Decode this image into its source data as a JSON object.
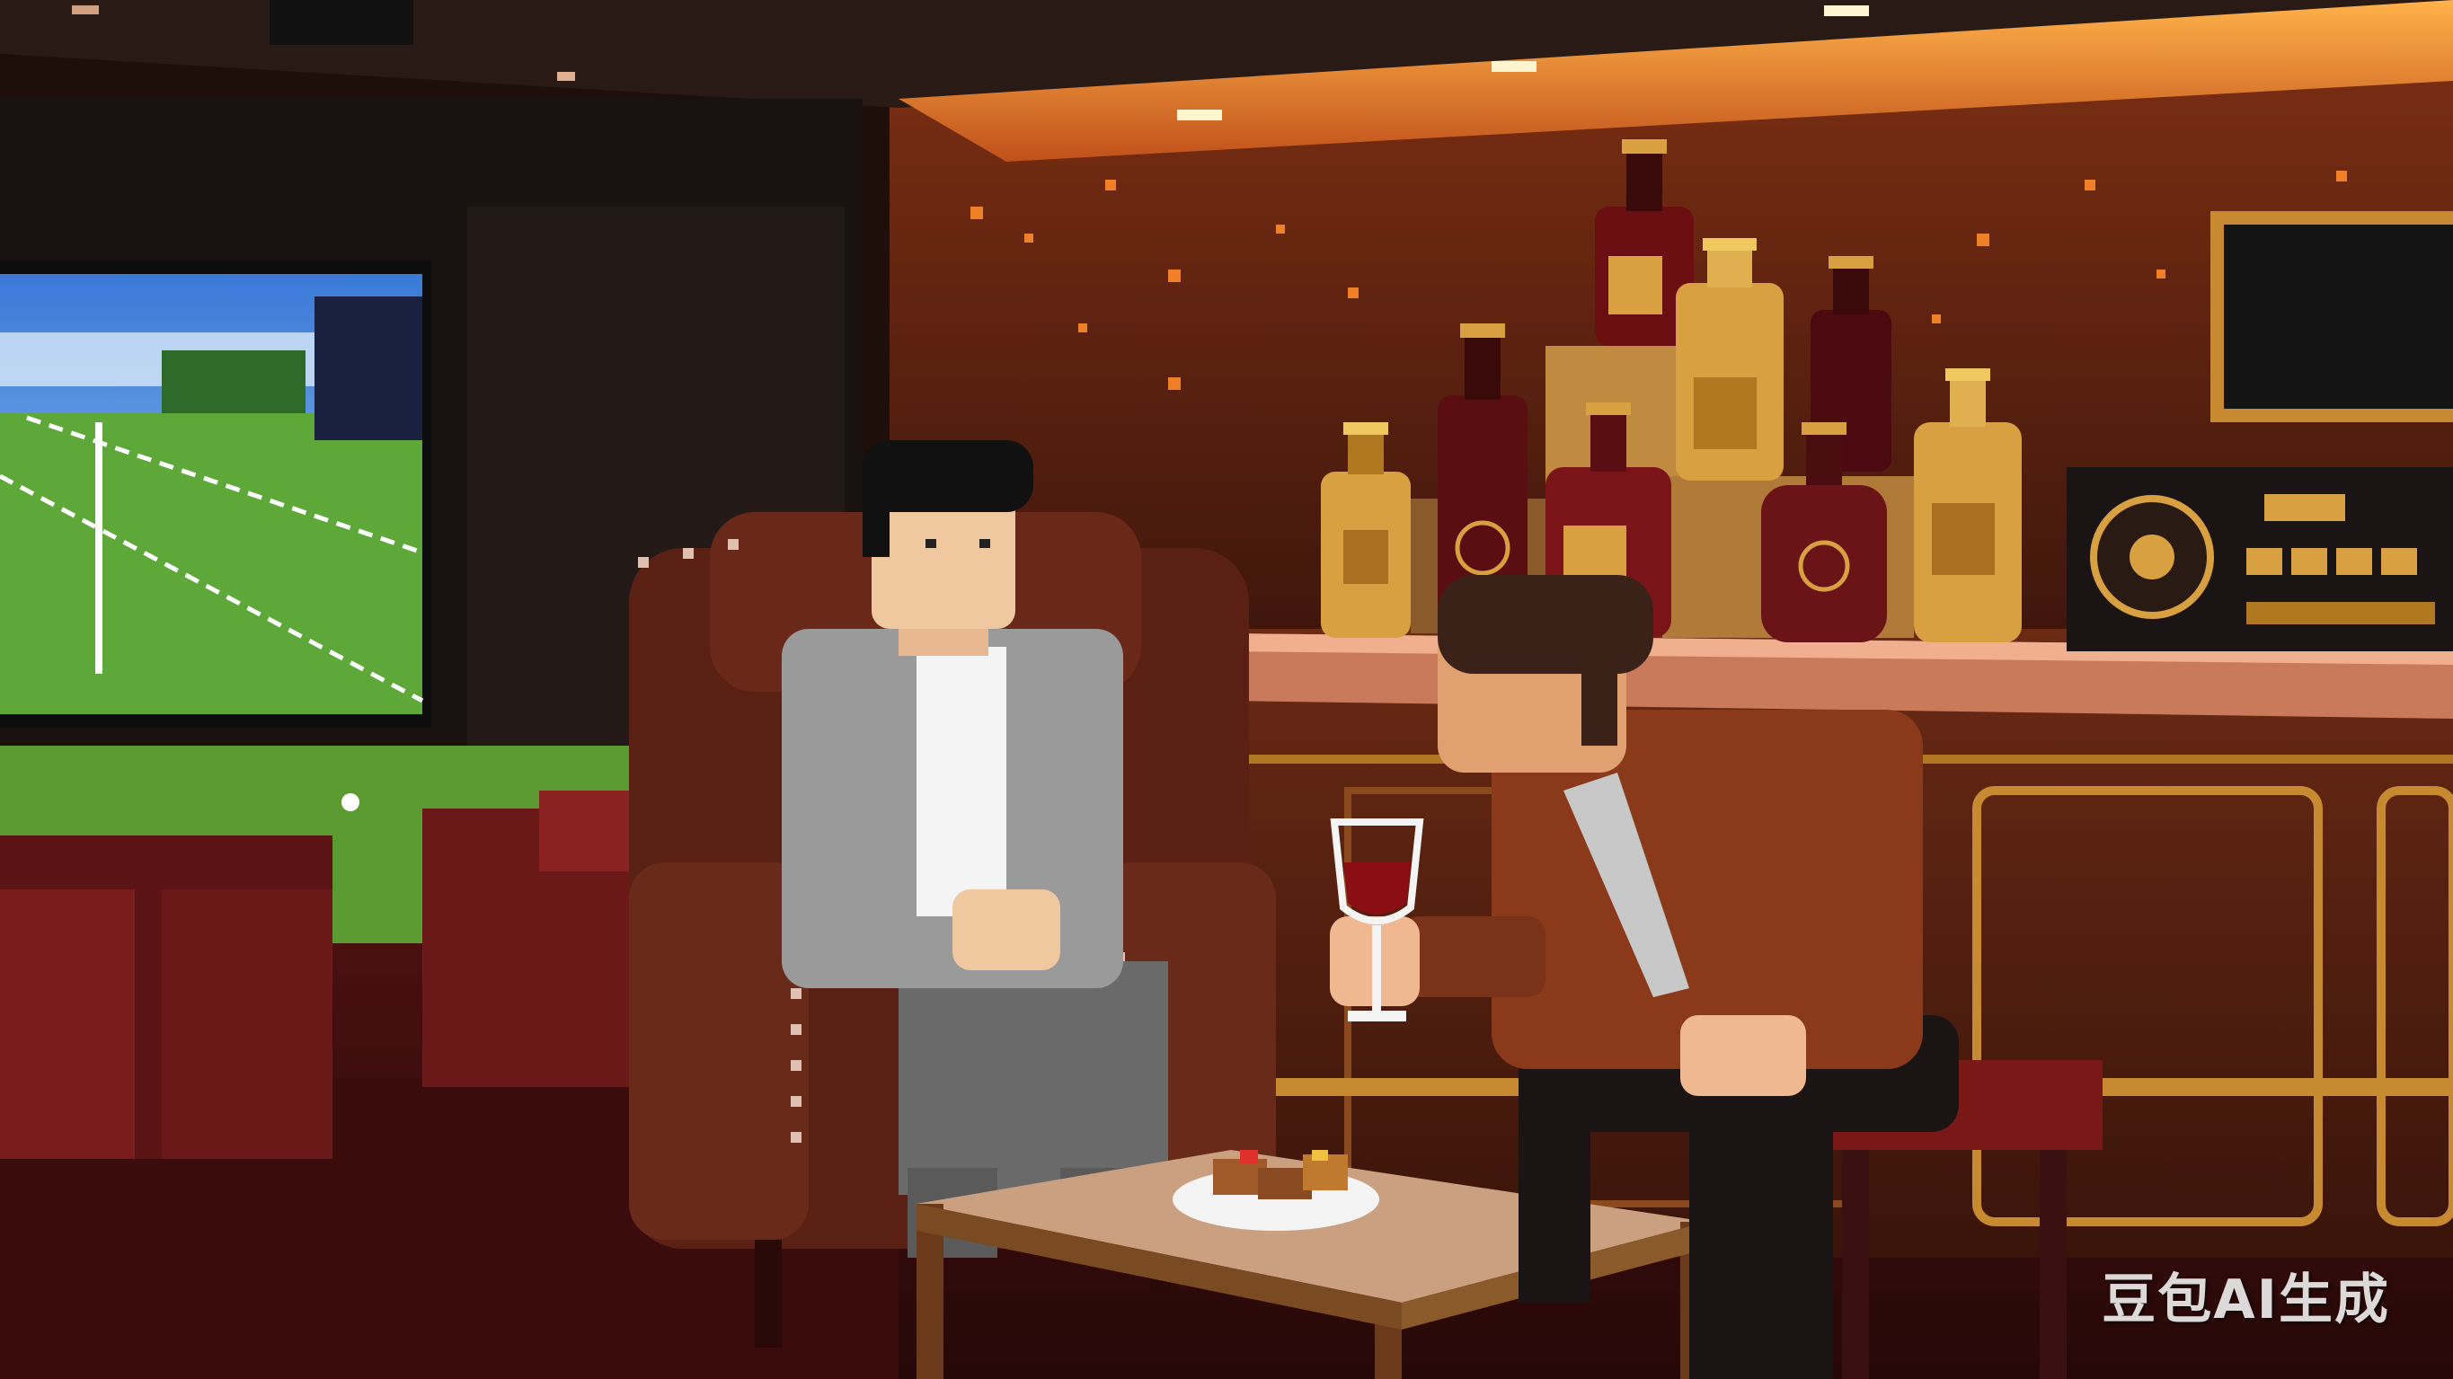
{
  "watermark": {
    "text": "豆包AI生成"
  },
  "colors": {
    "wall_dark": "#2a1410",
    "bar_wood": "#5a2412",
    "bar_top": "#d08060",
    "ceiling_glow": "#ff9a3a",
    "gold": "#d8a040",
    "armchair": "#5a2014",
    "carpet": "#3a0e0e",
    "grass": "#5ea83a",
    "sky": "#3a7ad8",
    "table_top": "#caa080"
  },
  "scene": {
    "description_icons": [
      "golf-simulator-screen",
      "armchair",
      "bar-counter",
      "liquor-bottles",
      "stereo-radio",
      "coffee-table",
      "snack-plate",
      "wine-glass"
    ]
  }
}
